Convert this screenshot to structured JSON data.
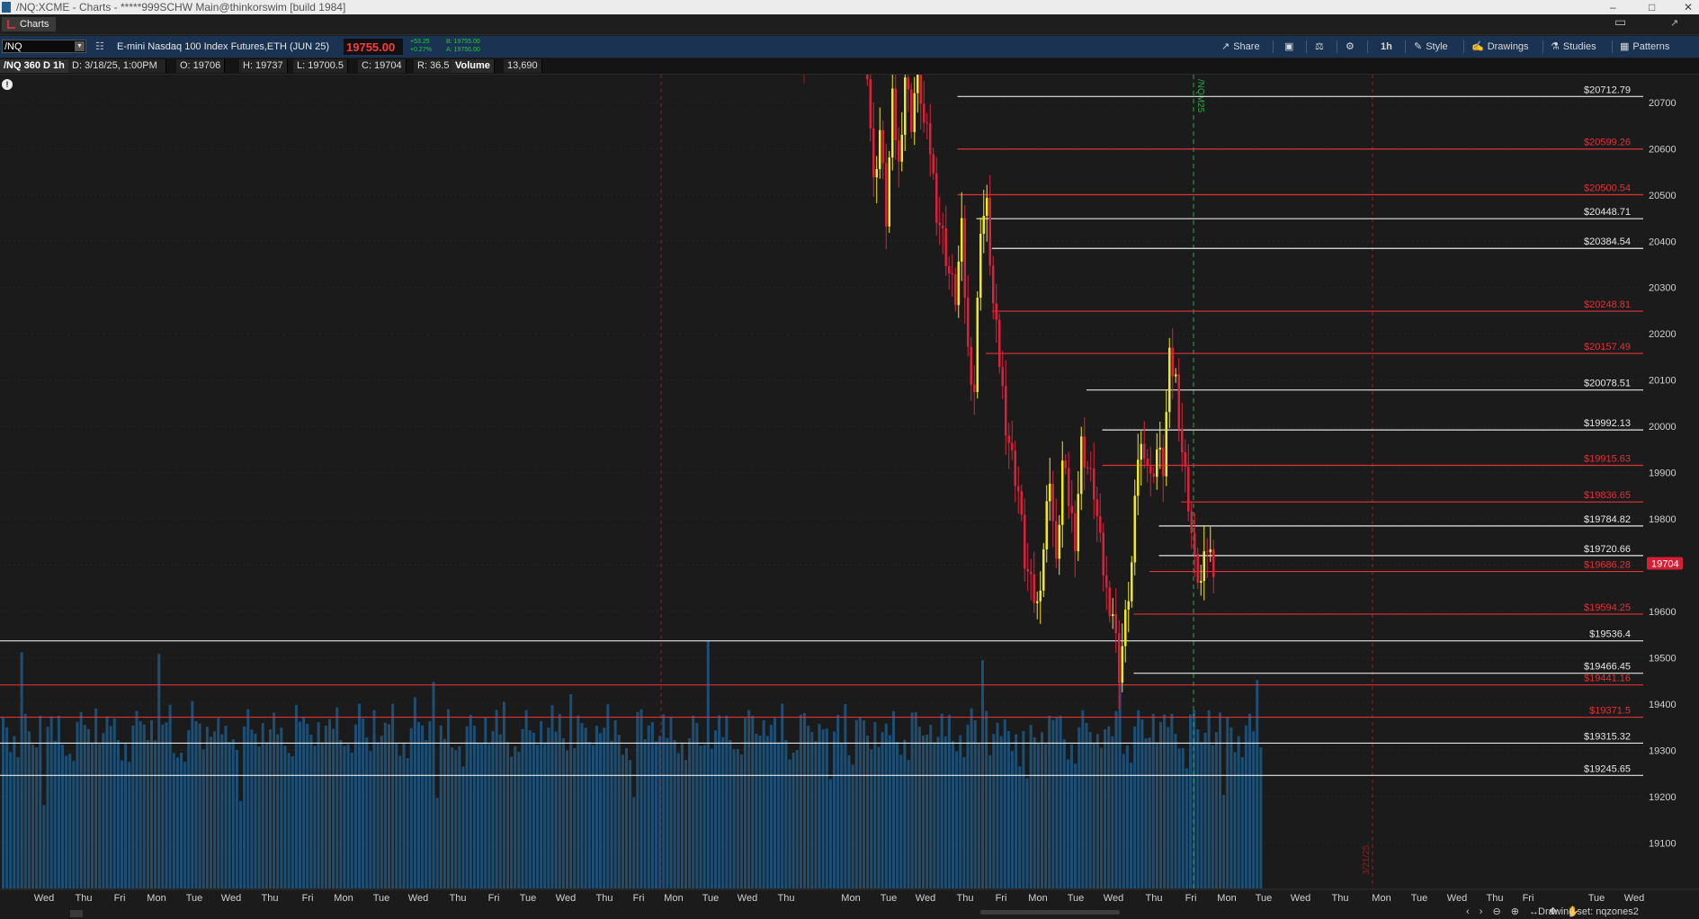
{
  "window": {
    "title": "/NQ:XCME - Charts - *****999SCHW Main@thinkorswim [build 1984]",
    "controls": [
      "–",
      "□",
      "✕"
    ]
  },
  "tabs": [
    {
      "label": "Charts"
    }
  ],
  "tabbar_right": {
    "icon1": "▭",
    "icon2": "↗"
  },
  "toolbar": {
    "symbol": "/NQ",
    "description": "E-mini Nasdaq 100 Index Futures,ETH (JUN 25)",
    "last_price": "19755.00",
    "change": "+53.25",
    "change_pct": "+0.27%",
    "bid": "B: 19755.00",
    "ask": "A: 19756.00",
    "buttons": {
      "share": "Share",
      "timeframe": "1h",
      "style": "Style",
      "drawings": "Drawings",
      "studies": "Studies",
      "patterns": "Patterns"
    }
  },
  "info_bar": {
    "symbol_period": "/NQ 360 D 1h",
    "date": "D: 3/18/25, 1:00PM",
    "open": "O: 19706",
    "high": "H: 19737",
    "low": "L: 19700.5",
    "close": "C: 19704",
    "range": "R: 36.5",
    "volume_label": "Volume",
    "volume": "13,690"
  },
  "chart_data": {
    "type": "candlestick",
    "price_axis": {
      "ticks": [
        20700,
        20600,
        20500,
        20400,
        20300,
        20200,
        20100,
        20000,
        19900,
        19800,
        19700,
        19600,
        19500,
        19400,
        19300,
        19200,
        19100
      ],
      "range": [
        19050,
        20760
      ],
      "current_price_label": "19704",
      "current_price": 19704
    },
    "time_axis": {
      "labels": [
        "Wed",
        "Thu",
        "Fri",
        "Mon",
        "Tue",
        "Wed",
        "Thu",
        "Fri",
        "Mon",
        "Tue",
        "Wed",
        "Thu",
        "Fri",
        "Tue",
        "Wed",
        "Thu",
        "Fri",
        "Mon",
        "Tue",
        "Wed",
        "Thu",
        "Mon",
        "Tue",
        "Wed",
        "Thu",
        "Fri",
        "Mon",
        "Tue",
        "Wed",
        "Thu",
        "Fri",
        "Mon",
        "Tue",
        "Wed",
        "Thu",
        "Mon",
        "Tue",
        "Wed",
        "Thu",
        "Fri",
        "Tue",
        "Wed"
      ]
    },
    "price_levels": [
      {
        "label": "$20712.79",
        "price": 20712.79,
        "color": "white",
        "from_hour": 29
      },
      {
        "label": "$20599.26",
        "price": 20599.26,
        "color": "red",
        "from_hour": 29
      },
      {
        "label": "$20500.54",
        "price": 20500.54,
        "color": "red",
        "from_hour": 29
      },
      {
        "label": "$20448.71",
        "price": 20448.71,
        "color": "white",
        "from_hour": 35
      },
      {
        "label": "$20384.54",
        "price": 20384.54,
        "color": "white",
        "from_hour": 40
      },
      {
        "label": "$20248.81",
        "price": 20248.81,
        "color": "red",
        "from_hour": 40
      },
      {
        "label": "$20157.49",
        "price": 20157.49,
        "color": "red",
        "from_hour": 38
      },
      {
        "label": "$20078.51",
        "price": 20078.51,
        "color": "white",
        "from_hour": 70
      },
      {
        "label": "$19992.13",
        "price": 19992.13,
        "color": "white",
        "from_hour": 75
      },
      {
        "label": "$19915.63",
        "price": 19915.63,
        "color": "red",
        "from_hour": 75
      },
      {
        "label": "$19836.65",
        "price": 19836.65,
        "color": "red",
        "from_hour": 100
      },
      {
        "label": "$19784.82",
        "price": 19784.82,
        "color": "white",
        "from_hour": 93
      },
      {
        "label": "$19720.66",
        "price": 19720.66,
        "color": "white",
        "from_hour": 93
      },
      {
        "label": "$19686.28",
        "price": 19686.28,
        "color": "red",
        "from_hour": 90
      },
      {
        "label": "$19594.25",
        "price": 19594.25,
        "color": "red",
        "from_hour": 85
      },
      {
        "label": "$19536.4",
        "price": 19536.4,
        "color": "white",
        "from_hour": 0
      },
      {
        "label": "$19466.45",
        "price": 19466.45,
        "color": "white",
        "from_hour": 85
      },
      {
        "label": "$19441.16",
        "price": 19441.16,
        "color": "red",
        "from_hour": 0
      },
      {
        "label": "$19371.5",
        "price": 19371.5,
        "color": "red",
        "from_hour": 0
      },
      {
        "label": "$19315.32",
        "price": 19315.32,
        "color": "white",
        "from_hour": 0
      },
      {
        "label": "$19245.65",
        "price": 19245.65,
        "color": "white",
        "from_hour": 0
      }
    ],
    "event_markers": [
      {
        "label": "/NQM25",
        "color": "green"
      },
      {
        "label": "3/21/25",
        "color": "red"
      }
    ],
    "close_path": [
      [
        0,
        20780
      ],
      [
        2,
        20520
      ],
      [
        4,
        20640
      ],
      [
        6,
        20450
      ],
      [
        8,
        20700
      ],
      [
        10,
        20560
      ],
      [
        12,
        20760
      ],
      [
        14,
        20660
      ],
      [
        16,
        20780
      ],
      [
        18,
        20650
      ],
      [
        20,
        20600
      ],
      [
        22,
        20470
      ],
      [
        24,
        20410
      ],
      [
        26,
        20330
      ],
      [
        28,
        20280
      ],
      [
        30,
        20420
      ],
      [
        32,
        20160
      ],
      [
        34,
        20080
      ],
      [
        36,
        20440
      ],
      [
        38,
        20470
      ],
      [
        40,
        20260
      ],
      [
        42,
        20140
      ],
      [
        44,
        20010
      ],
      [
        46,
        19930
      ],
      [
        48,
        19860
      ],
      [
        50,
        19710
      ],
      [
        52,
        19650
      ],
      [
        54,
        19610
      ],
      [
        56,
        19740
      ],
      [
        58,
        19900
      ],
      [
        60,
        19690
      ],
      [
        62,
        19920
      ],
      [
        64,
        19840
      ],
      [
        66,
        19760
      ],
      [
        68,
        19960
      ],
      [
        70,
        19910
      ],
      [
        72,
        19860
      ],
      [
        74,
        19740
      ],
      [
        76,
        19640
      ],
      [
        78,
        19600
      ],
      [
        80,
        19470
      ],
      [
        82,
        19580
      ],
      [
        84,
        19700
      ],
      [
        86,
        19940
      ],
      [
        88,
        19960
      ],
      [
        90,
        19880
      ],
      [
        92,
        19950
      ],
      [
        94,
        19910
      ],
      [
        96,
        20140
      ],
      [
        98,
        20100
      ],
      [
        100,
        19950
      ],
      [
        102,
        19840
      ],
      [
        104,
        19700
      ],
      [
        106,
        19660
      ],
      [
        108,
        19740
      ],
      [
        110,
        19704
      ]
    ],
    "volume_heights": [
      0.61,
      0.55,
      0.49,
      0.46,
      0.52,
      0.44,
      0.49,
      0.47,
      0.62,
      0.52,
      0.46,
      0.45,
      0.44,
      0.5,
      0.41,
      0.35,
      0.52,
      0.57,
      0.66,
      0.42,
      0.47,
      0.54,
      0.45,
      0.52,
      0.43,
      0.53,
      0.48,
      0.62,
      0.5,
      0.39,
      0.48,
      0.53,
      0.48,
      0.51,
      0.63,
      0.45,
      0.56,
      0.6,
      0.44,
      0.5,
      0.58,
      0.67,
      0.47,
      0.59,
      0.61,
      0.51,
      0.54,
      0.42,
      0.52,
      0.47,
      0.59,
      0.55,
      0.58,
      0.38,
      0.46,
      0.51,
      0.57,
      0.52,
      0.5,
      0.62,
      0.41,
      0.52,
      0.55,
      0.49,
      0.5,
      0.43,
      0.47,
      0.68,
      0.45,
      0.48,
      0.47,
      0.5,
      0.52,
      0.58,
      0.54,
      0.55,
      0.49,
      0.42,
      0.52,
      0.43,
      0.46,
      0.51,
      0.4,
      0.48,
      0.57,
      0.48,
      0.5,
      0.49,
      0.52,
      0.54,
      0.46,
      0.44,
      0.47,
      0.53,
      0.51,
      0.59,
      0.43,
      0.49,
      0.54,
      0.48,
      0.33,
      0.6,
      0.51,
      0.47,
      0.53,
      0.42,
      0.45,
      0.46,
      0.52,
      0.4
    ]
  }
}
